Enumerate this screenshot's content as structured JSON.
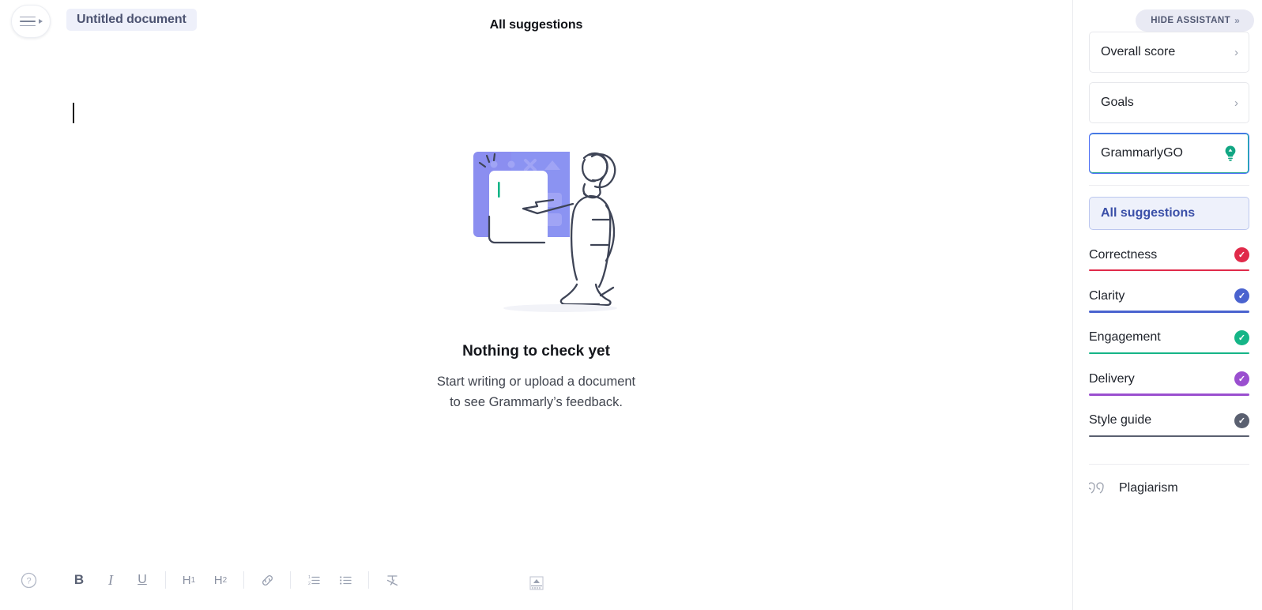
{
  "editor": {
    "menu_icon": "hamburger-menu-icon",
    "document_title": "Untitled document",
    "pane_title": "All suggestions"
  },
  "empty_state": {
    "illustration": "person-pointing-at-document-illustration",
    "title": "Nothing to check yet",
    "subtitle_line1": "Start writing or upload a document",
    "subtitle_line2": "to see Grammarly’s feedback."
  },
  "toolbar": {
    "help_label": "?",
    "bold_label": "B",
    "italic_label": "I",
    "underline_label": "U",
    "h1_label": "H",
    "h1_sub": "1",
    "h2_label": "H",
    "h2_sub": "2",
    "link_icon": "link-icon",
    "numbered_list_icon": "numbered-list-icon",
    "bullet_list_icon": "bullet-list-icon",
    "clear_format_icon": "clear-formatting-icon",
    "resize_icon": "resize-handle-icon"
  },
  "sidebar": {
    "hide_assistant_label": "HIDE ASSISTANT",
    "hide_assistant_chevron": "»",
    "cards": [
      {
        "label": "Overall score",
        "arrow": "›"
      },
      {
        "label": "Goals",
        "arrow": "›"
      },
      {
        "label": "GrammarlyGO",
        "icon": "lightbulb-icon"
      }
    ],
    "all_suggestions_label": "All suggestions",
    "categories": [
      {
        "label": "Correctness",
        "color": "#e02a4a",
        "check": "✓"
      },
      {
        "label": "Clarity",
        "color": "#4a63cf",
        "check": "✓"
      },
      {
        "label": "Engagement",
        "color": "#15b587",
        "check": "✓"
      },
      {
        "label": "Delivery",
        "color": "#9a4fcf",
        "check": "✓"
      },
      {
        "label": "Style guide",
        "color": "#5a6070",
        "check": "✓"
      }
    ],
    "plagiarism_label": "Plagiarism",
    "plagiarism_icon": "quotation-marks-icon"
  }
}
